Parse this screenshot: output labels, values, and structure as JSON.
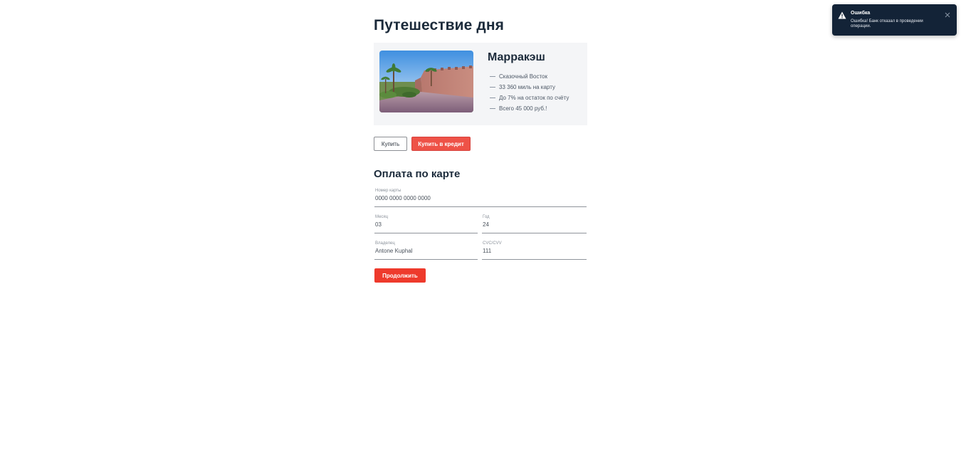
{
  "page": {
    "title": "Путешествие дня"
  },
  "offer": {
    "city": "Марракэш",
    "image_icon": "marrakech-photo",
    "features": [
      "Сказочный Восток",
      "33 360 миль на карту",
      "До 7% на остаток по счёту",
      "Всего 45 000 руб.!"
    ]
  },
  "actions": {
    "buy_label": "Купить",
    "credit_label": "Купить в кредит"
  },
  "payment": {
    "title": "Оплата по карте",
    "card_number": {
      "label": "Номер карты",
      "value": "0000 0000 0000 0000"
    },
    "month": {
      "label": "Месяц",
      "value": "03"
    },
    "year": {
      "label": "Год",
      "value": "24"
    },
    "owner": {
      "label": "Владелец",
      "value": "Antone Kuphal"
    },
    "cvc": {
      "label": "CVC/CVV",
      "value": "111"
    },
    "continue_label": "Продолжить"
  },
  "notification": {
    "title": "Ошибка",
    "message": "Ошибка! Банк отказал в проведении операции.",
    "icon": "warning-icon",
    "close_icon": "close-icon"
  },
  "colors": {
    "accent_red": "#ee3a2c",
    "credit_red": "#ee5247",
    "toast_bg": "#132337",
    "card_bg": "#f4f5f7",
    "title_text": "#1b2a3a"
  }
}
